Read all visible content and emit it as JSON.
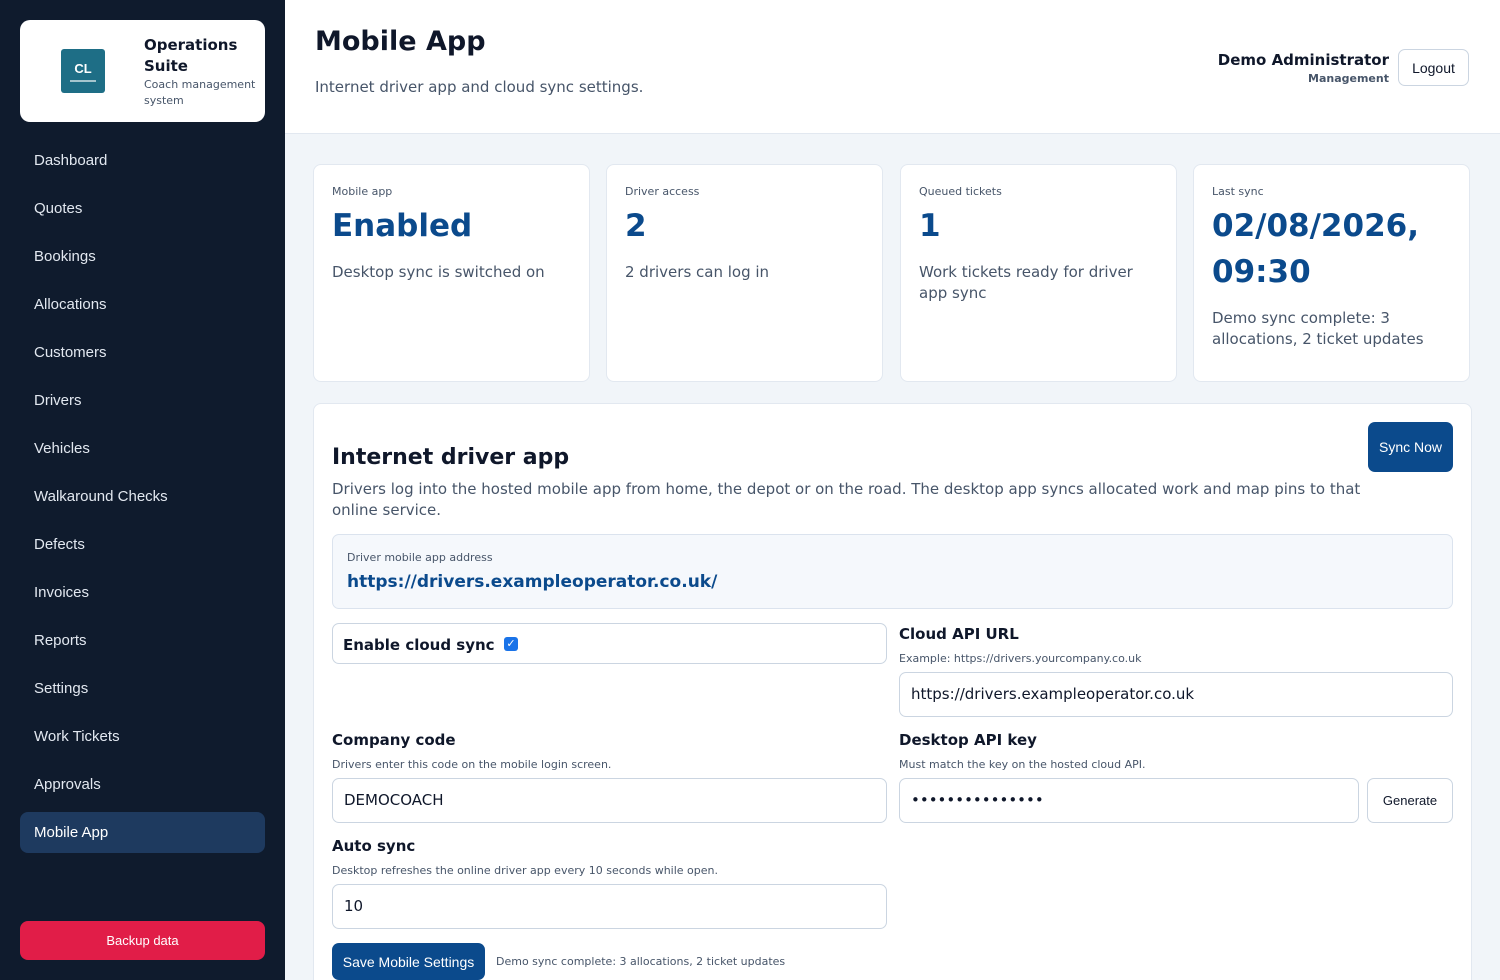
{
  "brand": {
    "logo_text": "CL",
    "title": "Operations Suite",
    "subtitle": "Coach management system"
  },
  "nav": {
    "items": [
      {
        "label": "Dashboard"
      },
      {
        "label": "Quotes"
      },
      {
        "label": "Bookings"
      },
      {
        "label": "Allocations"
      },
      {
        "label": "Customers"
      },
      {
        "label": "Drivers"
      },
      {
        "label": "Vehicles"
      },
      {
        "label": "Walkaround Checks"
      },
      {
        "label": "Defects"
      },
      {
        "label": "Invoices"
      },
      {
        "label": "Reports"
      },
      {
        "label": "Settings"
      },
      {
        "label": "Work Tickets"
      },
      {
        "label": "Approvals"
      },
      {
        "label": "Mobile App",
        "active": true
      }
    ],
    "backup_label": "Backup data"
  },
  "header": {
    "title": "Mobile App",
    "subtitle": "Internet driver app and cloud sync settings.",
    "user_name": "Demo Administrator",
    "user_role": "Management",
    "logout_label": "Logout"
  },
  "stats": [
    {
      "label": "Mobile app",
      "value": "Enabled",
      "desc": "Desktop sync is switched on"
    },
    {
      "label": "Driver access",
      "value": "2",
      "desc": "2 drivers can log in"
    },
    {
      "label": "Queued tickets",
      "value": "1",
      "desc": "Work tickets ready for driver app sync"
    },
    {
      "label": "Last sync",
      "value": "02/08/2026, 09:30",
      "desc": "Demo sync complete: 3 allocations, 2 ticket updates"
    }
  ],
  "panel": {
    "title": "Internet driver app",
    "description": "Drivers log into the hosted mobile app from home, the depot or on the road. The desktop app syncs allocated work and map pins to that online service.",
    "sync_button": "Sync Now",
    "address_label": "Driver mobile app address",
    "address_url": "https://drivers.exampleoperator.co.uk/",
    "cloud_sync_label": "Enable cloud sync",
    "cloud_sync_enabled": true,
    "cloud_api": {
      "label": "Cloud API URL",
      "help": "Example: https://drivers.yourcompany.co.uk",
      "value": "https://drivers.exampleoperator.co.uk"
    },
    "company_code": {
      "label": "Company code",
      "help": "Drivers enter this code on the mobile login screen.",
      "value": "DEMOCOACH"
    },
    "api_key": {
      "label": "Desktop API key",
      "help": "Must match the key on the hosted cloud API.",
      "value": "•••••••••••••••",
      "generate_label": "Generate"
    },
    "auto_sync": {
      "label": "Auto sync",
      "help": "Desktop refreshes the online driver app every 10 seconds while open.",
      "value": "10"
    },
    "save_label": "Save Mobile Settings",
    "save_status": "Demo sync complete: 3 allocations, 2 ticket updates"
  }
}
